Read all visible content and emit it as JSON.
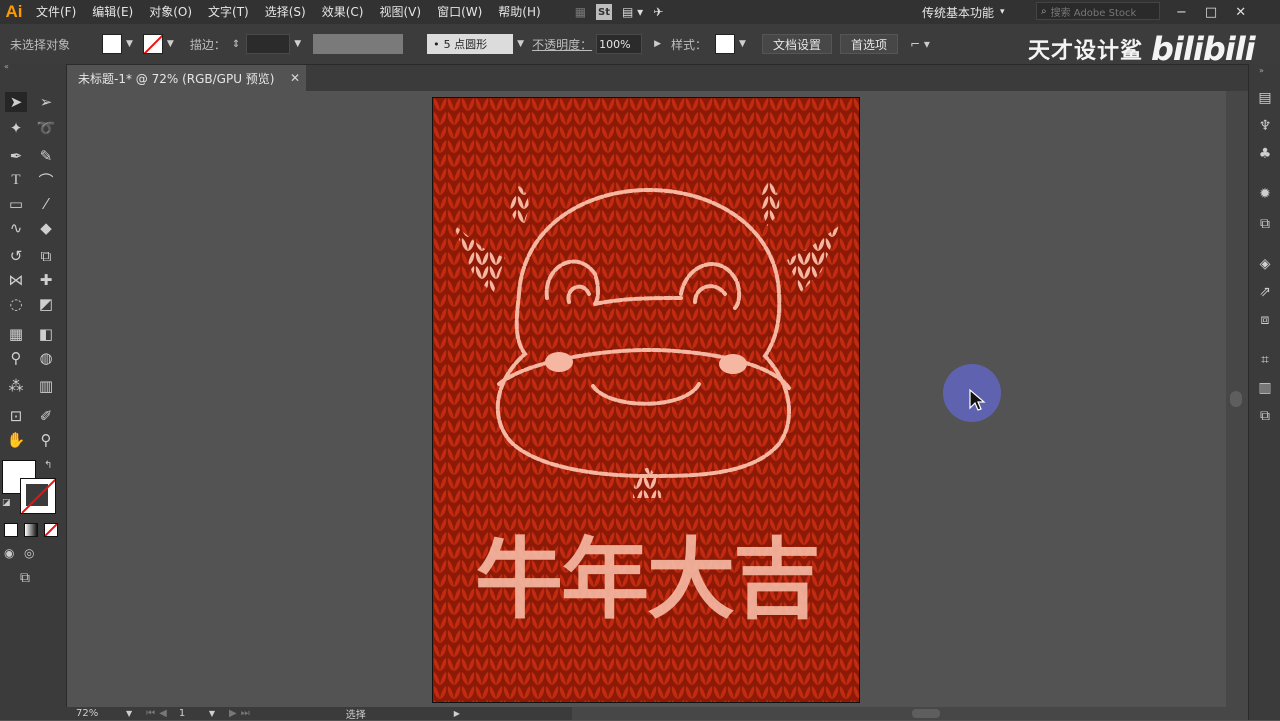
{
  "app": {
    "logo": "Ai",
    "menus": [
      "文件(F)",
      "编辑(E)",
      "对象(O)",
      "文字(T)",
      "选择(S)",
      "效果(C)",
      "视图(V)",
      "窗口(W)",
      "帮助(H)"
    ],
    "stock_badge": "St",
    "workspace": "传统基本功能",
    "search_placeholder": "搜索 Adobe Stock",
    "window_minimize": "−",
    "window_maximize": "□",
    "window_close": "✕"
  },
  "control_bar": {
    "selection_status": "未选择对象",
    "stroke_label": "描边：",
    "brush_value": "5 点圆形",
    "opacity_label": "不透明度：",
    "opacity_value": "100%",
    "style_label": "样式：",
    "doc_setup_button": "文档设置",
    "preferences_button": "首选项"
  },
  "document": {
    "tab_title": "未标题-1* @ 72% (RGB/GPU 预览)",
    "close_glyph": "✕"
  },
  "status_bar": {
    "zoom": "72%",
    "artboard_number": "1",
    "mode": "选择"
  },
  "artwork": {
    "knit_color": "#c32b10",
    "knit_dark": "#8c1a06",
    "highlight_color": "#f5b7a2",
    "caption": "牛年大吉"
  },
  "watermark": {
    "channel": "天才设计鲨",
    "platform": "bilibili"
  },
  "colors": {
    "accent": "#ff9a00",
    "cursor_halo": "#6064b8"
  }
}
